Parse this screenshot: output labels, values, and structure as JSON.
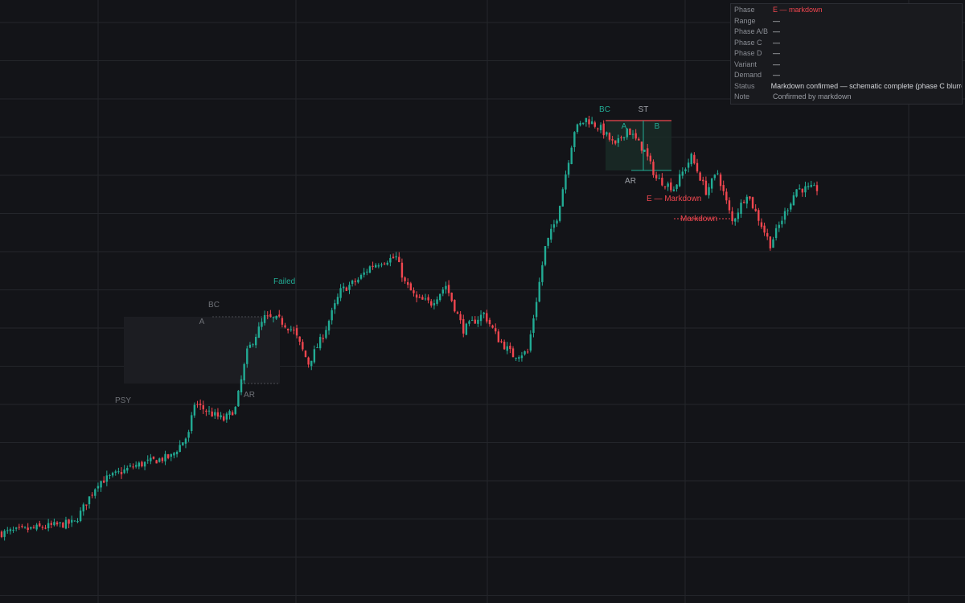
{
  "panel": {
    "rows": [
      {
        "key": "Phase",
        "value": "E — markdown",
        "tone": "red"
      },
      {
        "key": "Range",
        "value": "—",
        "tone": "normal"
      },
      {
        "key": "Phase A/B",
        "value": "—",
        "tone": "normal"
      },
      {
        "key": "Phase C",
        "value": "—",
        "tone": "normal"
      },
      {
        "key": "Phase D",
        "value": "—",
        "tone": "normal"
      },
      {
        "key": "Variant",
        "value": "—",
        "tone": "normal"
      },
      {
        "key": "Demand",
        "value": "—",
        "tone": "normal"
      },
      {
        "key": "Status",
        "value": "Markdown confirmed — schematic complete (phase C blurred)",
        "tone": "normal"
      },
      {
        "key": "Note",
        "value": "Confirmed by markdown",
        "tone": "muted"
      }
    ]
  },
  "colors": {
    "background": "#131418",
    "grid": "#24262b",
    "up": "#22ab94",
    "down": "#f0464f",
    "label_muted": "#6f7278",
    "label_green": "#22ab94",
    "label_red": "#f0464f"
  },
  "chart_data": {
    "type": "candlestick",
    "title": "",
    "xlabel": "",
    "ylabel": "",
    "grid": true,
    "x_axis_labels_shown": false,
    "y_axis_labels_shown": false,
    "bar_count": 280,
    "waypoints": [
      [
        0,
        37
      ],
      [
        25,
        50
      ],
      [
        33,
        100
      ],
      [
        38,
        108
      ],
      [
        45,
        120
      ],
      [
        52,
        127
      ],
      [
        58,
        132
      ],
      [
        64,
        160
      ],
      [
        66,
        198
      ],
      [
        72,
        185
      ],
      [
        76,
        178
      ],
      [
        80,
        192
      ],
      [
        84,
        262
      ],
      [
        90,
        305
      ],
      [
        95,
        302
      ],
      [
        100,
        288
      ],
      [
        105,
        248
      ],
      [
        110,
        283
      ],
      [
        116,
        338
      ],
      [
        122,
        352
      ],
      [
        126,
        368
      ],
      [
        130,
        375
      ],
      [
        135,
        380
      ],
      [
        138,
        348
      ],
      [
        142,
        328
      ],
      [
        147,
        323
      ],
      [
        152,
        345
      ],
      [
        158,
        290
      ],
      [
        165,
        310
      ],
      [
        170,
        278
      ],
      [
        175,
        258
      ],
      [
        180,
        262
      ],
      [
        186,
        392
      ],
      [
        190,
        430
      ],
      [
        196,
        538
      ],
      [
        200,
        552
      ],
      [
        205,
        540
      ],
      [
        210,
        518
      ],
      [
        214,
        540
      ],
      [
        220,
        512
      ],
      [
        224,
        478
      ],
      [
        230,
        466
      ],
      [
        236,
        505
      ],
      [
        241,
        462
      ],
      [
        245,
        485
      ],
      [
        250,
        424
      ],
      [
        255,
        460
      ],
      [
        263,
        396
      ],
      [
        268,
        435
      ],
      [
        272,
        465
      ]
    ],
    "annotations": [
      {
        "text": "PSY",
        "tone": "muted"
      },
      {
        "text": "BC",
        "tone": "muted"
      },
      {
        "text": "A",
        "tone": "muted"
      },
      {
        "text": "AR",
        "tone": "muted"
      },
      {
        "text": "Failed",
        "tone": "green"
      },
      {
        "text": "BC",
        "tone": "green"
      },
      {
        "text": "ST",
        "tone": "white"
      },
      {
        "text": "A",
        "tone": "green"
      },
      {
        "text": "B",
        "tone": "green"
      },
      {
        "text": "AR",
        "tone": "white"
      },
      {
        "text": "E — Markdown",
        "tone": "red"
      },
      {
        "text": "Markdown",
        "tone": "red"
      }
    ]
  }
}
